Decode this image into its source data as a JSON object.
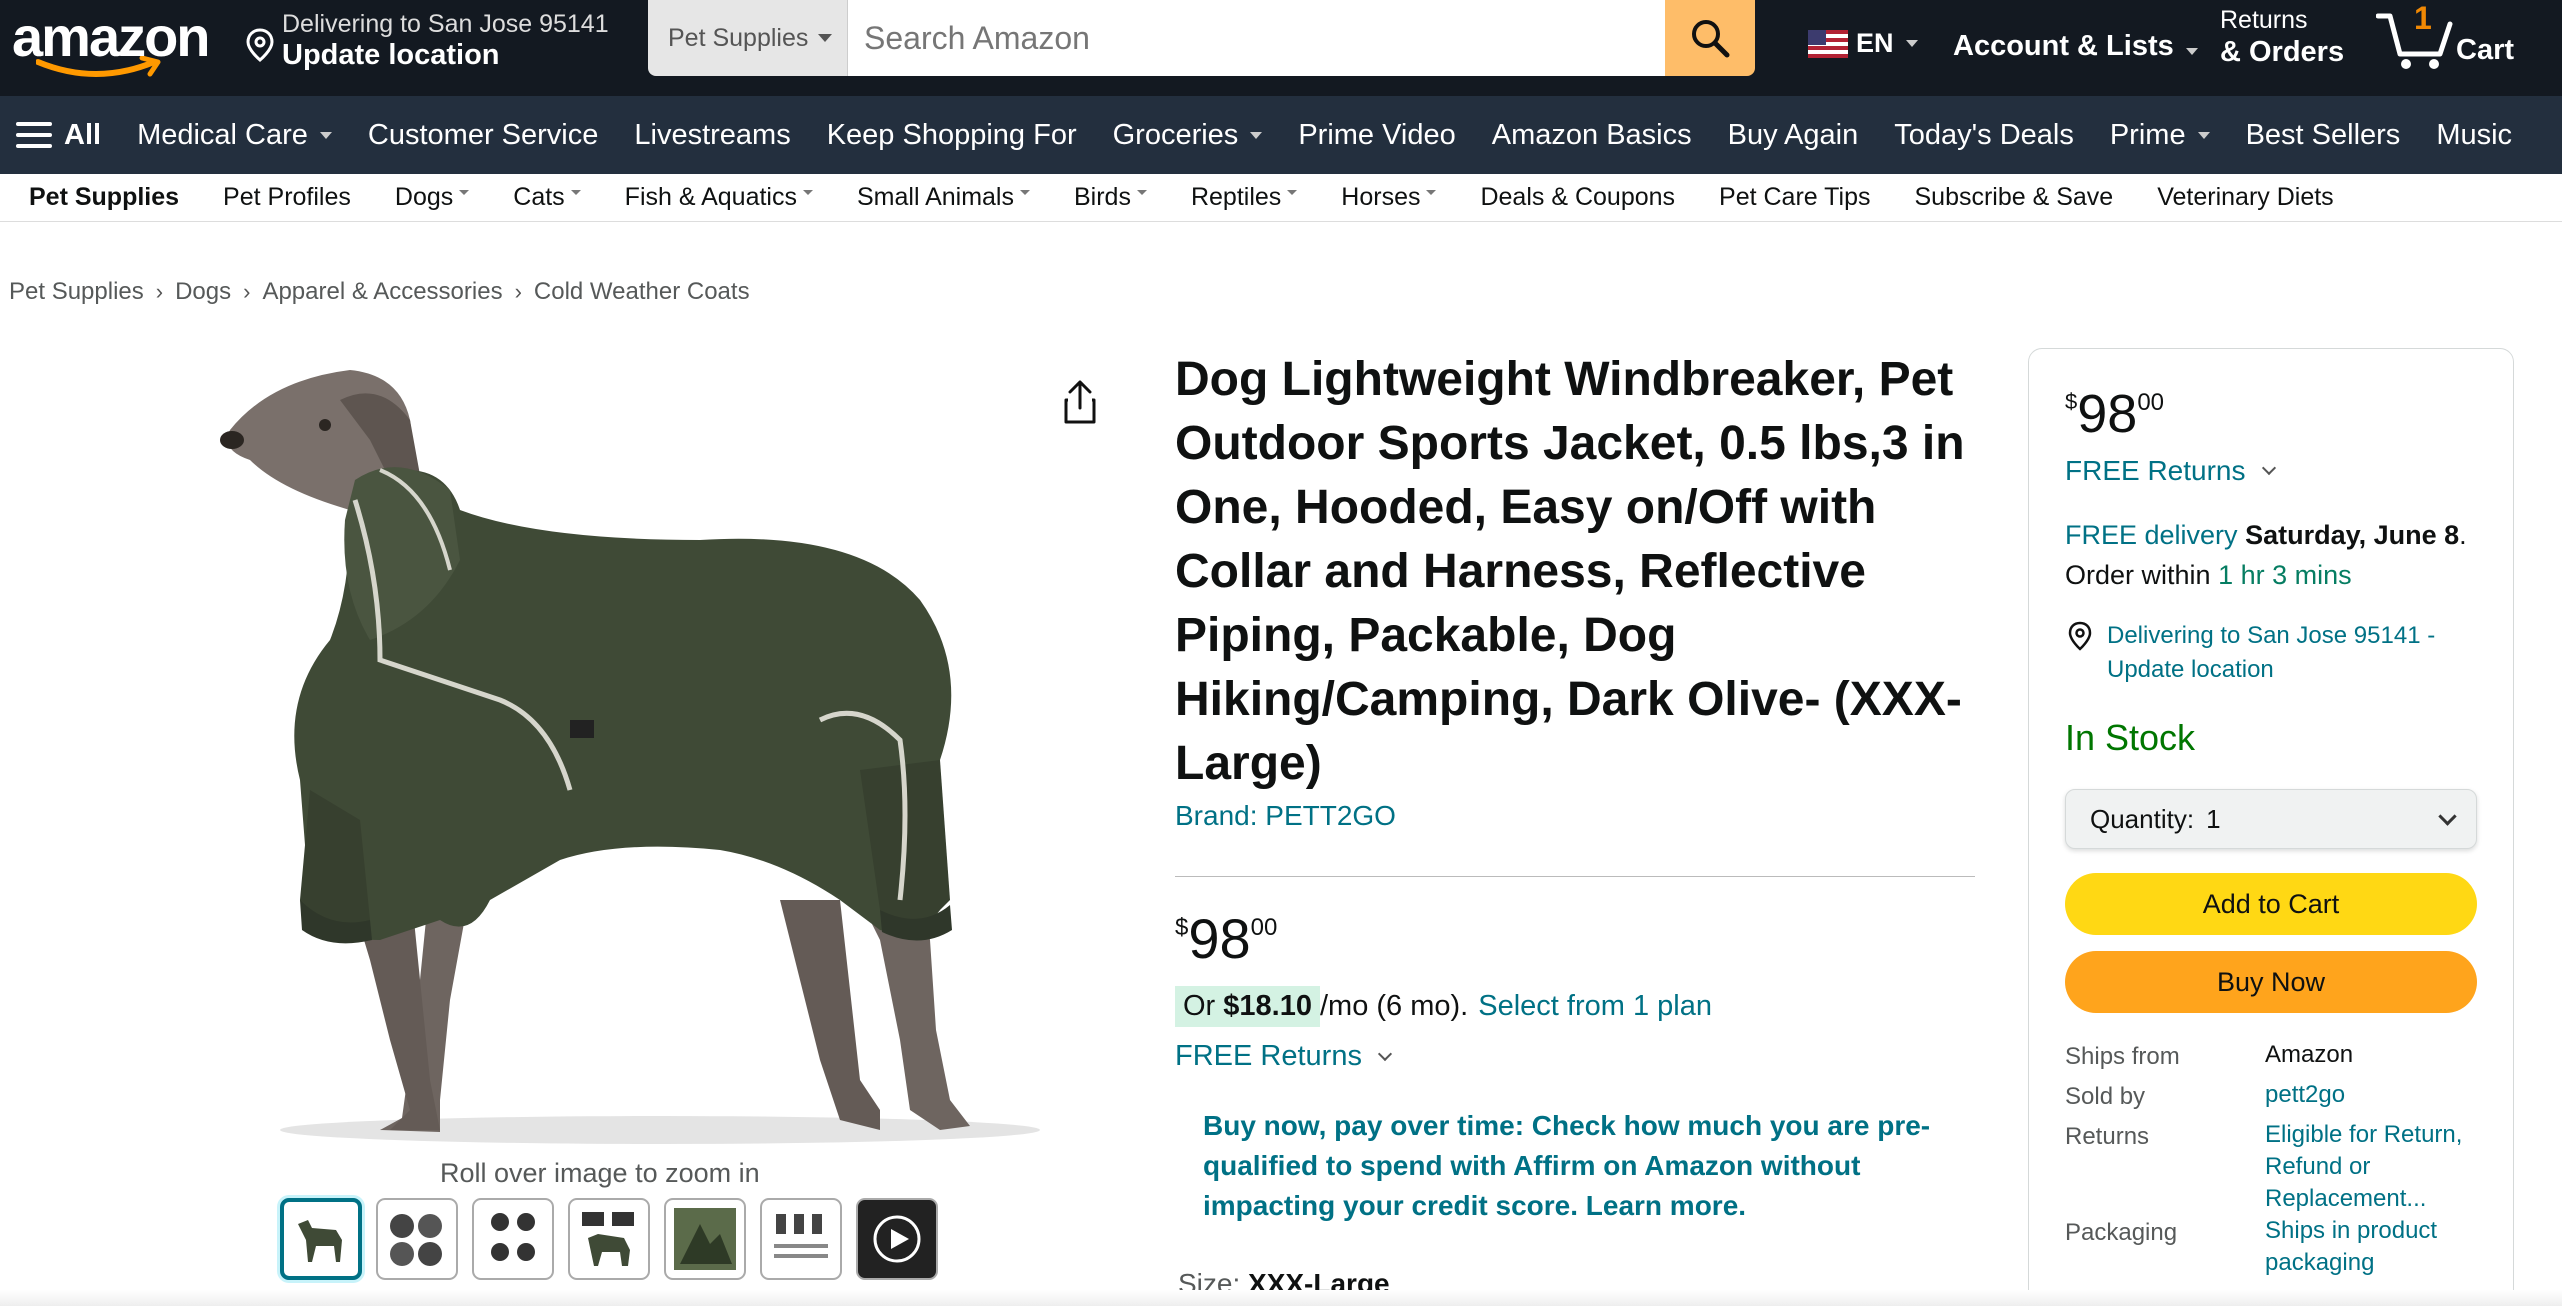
{
  "header": {
    "logo_text": "amazon",
    "deliver_line1": "Delivering to San Jose 95141",
    "deliver_line2": "Update location",
    "search_category": "Pet Supplies",
    "search_placeholder": "Search Amazon",
    "language": "EN",
    "account_label": "Account & Lists",
    "returns_line1": "Returns",
    "returns_line2": "& Orders",
    "cart_count": "1",
    "cart_label": "Cart"
  },
  "nav": {
    "all_label": "All",
    "items": [
      "Medical Care",
      "Customer Service",
      "Livestreams",
      "Keep Shopping For",
      "Groceries",
      "Prime Video",
      "Amazon Basics",
      "Buy Again",
      "Today's Deals",
      "Prime",
      "Best Sellers",
      "Music"
    ]
  },
  "subnav": {
    "items": [
      "Pet Supplies",
      "Pet Profiles",
      "Dogs",
      "Cats",
      "Fish & Aquatics",
      "Small Animals",
      "Birds",
      "Reptiles",
      "Horses",
      "Deals & Coupons",
      "Pet Care Tips",
      "Subscribe & Save",
      "Veterinary Diets"
    ]
  },
  "breadcrumb": [
    "Pet Supplies",
    "Dogs",
    "Apparel & Accessories",
    "Cold Weather Coats"
  ],
  "gallery": {
    "zoom_hint": "Roll over image to zoom in",
    "thumb_count": 7
  },
  "product": {
    "title": "Dog Lightweight Windbreaker, Pet Outdoor Sports Jacket, 0.5 lbs,3 in One, Hooded, Easy on/Off with Collar and Harness, Reflective Piping, Packable, Dog Hiking/Camping, Dark Olive- (XXX-Large)",
    "brand": "Brand: PETT2GO",
    "price_symbol": "$",
    "price_whole": "98",
    "price_fraction": "00",
    "monthly_prefix": "Or ",
    "monthly_amount": "$18.10",
    "monthly_suffix": "/mo (6 mo).",
    "monthly_link": "Select from 1 plan",
    "free_returns": "FREE Returns",
    "affirm_text": "Buy now, pay over time: Check how much you are pre-qualified to spend with Affirm on Amazon without impacting your credit score. Learn more.",
    "size_label": "Size: ",
    "size_value": "XXX-Large"
  },
  "buybox": {
    "price_symbol": "$",
    "price_whole": "98",
    "price_fraction": "00",
    "free_returns": "FREE Returns",
    "free_delivery": "FREE delivery",
    "delivery_date": "Saturday, June 8",
    "order_within_prefix": "Order within",
    "order_within_time": "1 hr 3 mins",
    "location_text": "Delivering to San Jose 95141 - Update location",
    "stock": "In Stock",
    "quantity_label": "Quantity:",
    "quantity_value": "1",
    "add_to_cart": "Add to Cart",
    "buy_now": "Buy Now",
    "ships_from_label": "Ships from",
    "ships_from_value": "Amazon",
    "sold_by_label": "Sold by",
    "sold_by_value": "pett2go",
    "returns_label": "Returns",
    "returns_value": "Eligible for Return, Refund or Replacement...",
    "packaging_label": "Packaging",
    "packaging_value": "Ships in product packaging"
  },
  "colors": {
    "header_bg": "#131921",
    "nav_bg": "#232F3E",
    "search_button": "#FEBD69",
    "link": "#007185",
    "add_to_cart": "#FFD814",
    "buy_now": "#FFA41C",
    "in_stock": "#007600",
    "jacket": "#3F4A36"
  }
}
